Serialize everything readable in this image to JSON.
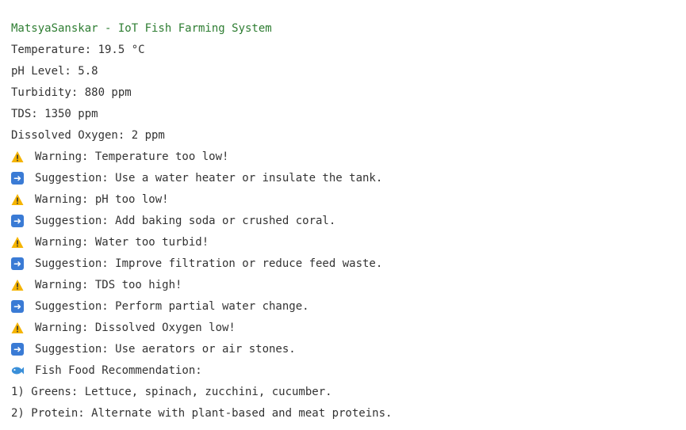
{
  "title": "MatsyaSanskar - IoT Fish Farming System",
  "readings": [
    "Temperature: 19.5 °C",
    "pH Level: 5.8",
    "Turbidity: 880 ppm",
    "TDS: 1350 ppm",
    "Dissolved Oxygen: 2 ppm"
  ],
  "alerts": [
    {
      "type": "warning",
      "icon": "warning-icon",
      "text": "Warning: Temperature too low!"
    },
    {
      "type": "suggestion",
      "icon": "right-arrow-icon",
      "text": "Suggestion: Use a water heater or insulate the tank."
    },
    {
      "type": "warning",
      "icon": "warning-icon",
      "text": "Warning: pH too low!"
    },
    {
      "type": "suggestion",
      "icon": "right-arrow-icon",
      "text": "Suggestion: Add baking soda or crushed coral."
    },
    {
      "type": "warning",
      "icon": "warning-icon",
      "text": "Warning: Water too turbid!"
    },
    {
      "type": "suggestion",
      "icon": "right-arrow-icon",
      "text": "Suggestion: Improve filtration or reduce feed waste."
    },
    {
      "type": "warning",
      "icon": "warning-icon",
      "text": "Warning: TDS too high!"
    },
    {
      "type": "suggestion",
      "icon": "right-arrow-icon",
      "text": "Suggestion: Perform partial water change."
    },
    {
      "type": "warning",
      "icon": "warning-icon",
      "text": "Warning: Dissolved Oxygen low!"
    },
    {
      "type": "suggestion",
      "icon": "right-arrow-icon",
      "text": "Suggestion: Use aerators or air stones."
    }
  ],
  "food": {
    "icon": "fish-icon",
    "heading": "Fish Food Recommendation:",
    "items": [
      "1) Greens: Lettuce, spinach, zucchini, cucumber.",
      "2) Protein: Alternate with plant-based and meat proteins."
    ]
  },
  "colors": {
    "title": "#2e7d32",
    "text": "#333333",
    "warning_fill": "#f5b400",
    "arrow_fill": "#3a7bd5",
    "fish": "#3a8fd9"
  }
}
